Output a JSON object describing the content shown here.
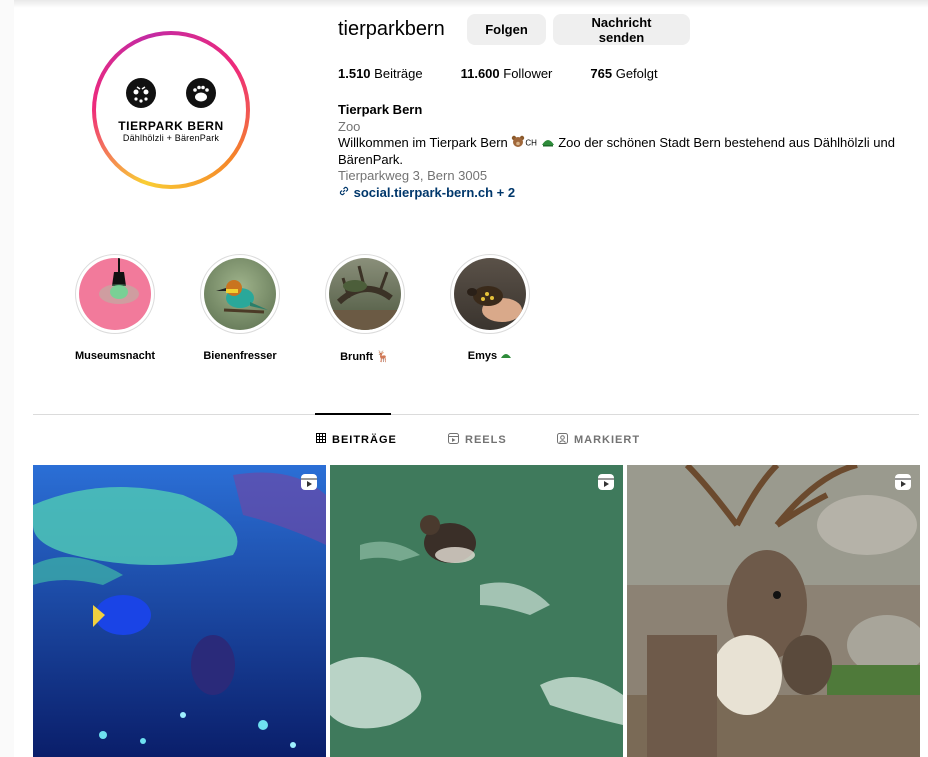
{
  "profile": {
    "username": "tierparkbern",
    "follow_label": "Folgen",
    "message_label": "Nachricht senden",
    "logo": {
      "name": "TIERPARK BERN",
      "subtitle": "Dählhölzli + BärenPark"
    }
  },
  "stats": {
    "posts_count": "1.510",
    "posts_label": "Beiträge",
    "followers_count": "11.600",
    "followers_label": "Follower",
    "following_count": "765",
    "following_label": "Gefolgt"
  },
  "bio": {
    "full_name": "Tierpark Bern",
    "category": "Zoo",
    "text_start": "Willkommen im Tierpark Bern",
    "text_ch": "CH",
    "text_rest": "Zoo der schönen Stadt Bern bestehend aus Dählhölzli und BärenPark.",
    "address": "Tierparkweg 3, Bern 3005",
    "link": "social.tierpark-bern.ch + 2"
  },
  "highlights": [
    {
      "label": "Museumsnacht",
      "icon": "lightbulb-icon"
    },
    {
      "label": "Bienenfresser",
      "icon": "bird-photo"
    },
    {
      "label": "Brunft",
      "icon": "deer-emoji"
    },
    {
      "label": "Emys",
      "icon": "turtle-emoji"
    }
  ],
  "tabs": [
    {
      "label": "BEITRÄGE",
      "icon": "grid-icon",
      "active": true
    },
    {
      "label": "REELS",
      "icon": "reels-icon",
      "active": false
    },
    {
      "label": "MARKIERT",
      "icon": "tagged-icon",
      "active": false
    }
  ],
  "posts": [
    {
      "kind": "reel",
      "subject": "aquarium fish"
    },
    {
      "kind": "reel",
      "subject": "duck on water"
    },
    {
      "kind": "reel",
      "subject": "reindeer"
    }
  ],
  "colors": {
    "link": "#00376b",
    "muted": "#737373",
    "button_bg": "#efefef",
    "divider": "#dbdbdb"
  }
}
